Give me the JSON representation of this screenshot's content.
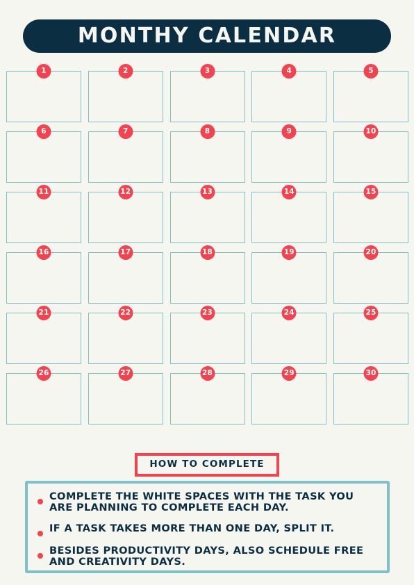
{
  "page": {
    "background_color": "#f6f6f1",
    "accent_red": "#f4424e",
    "accent_teal": "#7fc0c7",
    "accent_navy": "#0b2e43"
  },
  "header": {
    "title": "Monthy Calendar"
  },
  "calendar": {
    "columns": 5,
    "rows": 6,
    "days": [
      {
        "number": "1"
      },
      {
        "number": "2"
      },
      {
        "number": "3"
      },
      {
        "number": "4"
      },
      {
        "number": "5"
      },
      {
        "number": "6"
      },
      {
        "number": "7"
      },
      {
        "number": "8"
      },
      {
        "number": "9"
      },
      {
        "number": "10"
      },
      {
        "number": "11"
      },
      {
        "number": "12"
      },
      {
        "number": "13"
      },
      {
        "number": "14"
      },
      {
        "number": "15"
      },
      {
        "number": "16"
      },
      {
        "number": "17"
      },
      {
        "number": "18"
      },
      {
        "number": "19"
      },
      {
        "number": "20"
      },
      {
        "number": "21"
      },
      {
        "number": "22"
      },
      {
        "number": "23"
      },
      {
        "number": "24"
      },
      {
        "number": "25"
      },
      {
        "number": "26"
      },
      {
        "number": "27"
      },
      {
        "number": "28"
      },
      {
        "number": "29"
      },
      {
        "number": "30"
      }
    ]
  },
  "howto": {
    "heading": "How to complete",
    "instructions": [
      {
        "text": "Complete the white spaces with the task you are planning to complete each day."
      },
      {
        "text": "If a task takes more than one day, split it."
      },
      {
        "text": "Besides productivity days, also schedule free and creativity days."
      }
    ]
  }
}
